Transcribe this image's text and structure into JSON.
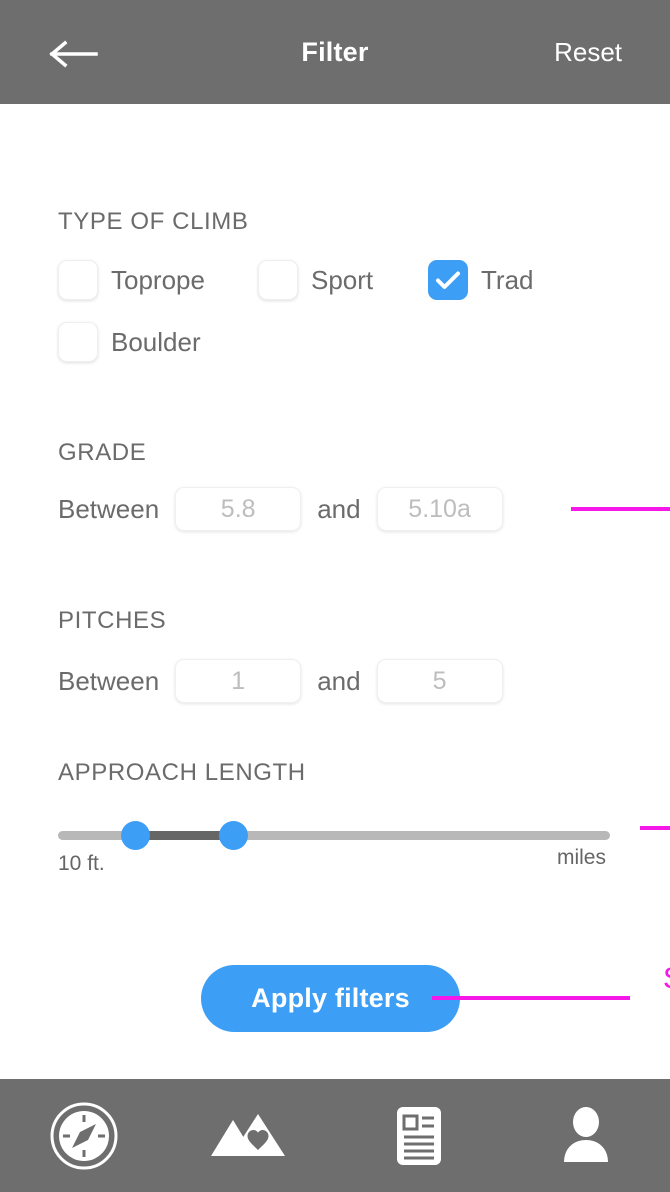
{
  "header": {
    "title": "Filter",
    "back_icon": "arrow-left-icon",
    "reset_label": "Reset"
  },
  "colors": {
    "header_bg": "#6e6e6e",
    "accent_blue": "#3d9ef5",
    "annotation_magenta": "#f618e8",
    "text_gray": "#6b6b6b",
    "track_gray": "#b8b8b8",
    "fill_gray": "#666666"
  },
  "sections": {
    "type_of_climb": {
      "title": "TYPE OF CLIMB",
      "options": [
        {
          "label": "Toprope",
          "checked": false
        },
        {
          "label": "Sport",
          "checked": false
        },
        {
          "label": "Trad",
          "checked": true
        },
        {
          "label": "Boulder",
          "checked": false
        }
      ]
    },
    "grade": {
      "title": "GRADE",
      "between_label": "Between",
      "and_label": "and",
      "min_placeholder": "5.8",
      "min_value": "",
      "max_placeholder": "5.10a",
      "max_value": ""
    },
    "pitches": {
      "title": "PITCHES",
      "between_label": "Between",
      "and_label": "and",
      "min_placeholder": "1",
      "min_value": "",
      "max_placeholder": "5",
      "max_value": ""
    },
    "approach_length": {
      "title": "APPROACH LENGTH",
      "min_label": "10 ft.",
      "max_label": "miles"
    }
  },
  "apply_button": {
    "label": "Apply filters"
  },
  "annotations": {
    "callout_text": "S"
  },
  "bottom_nav": {
    "items": [
      {
        "icon": "compass-icon",
        "name": "explore"
      },
      {
        "icon": "mountain-heart-icon",
        "name": "saved"
      },
      {
        "icon": "article-icon",
        "name": "news"
      },
      {
        "icon": "person-icon",
        "name": "profile"
      }
    ]
  }
}
